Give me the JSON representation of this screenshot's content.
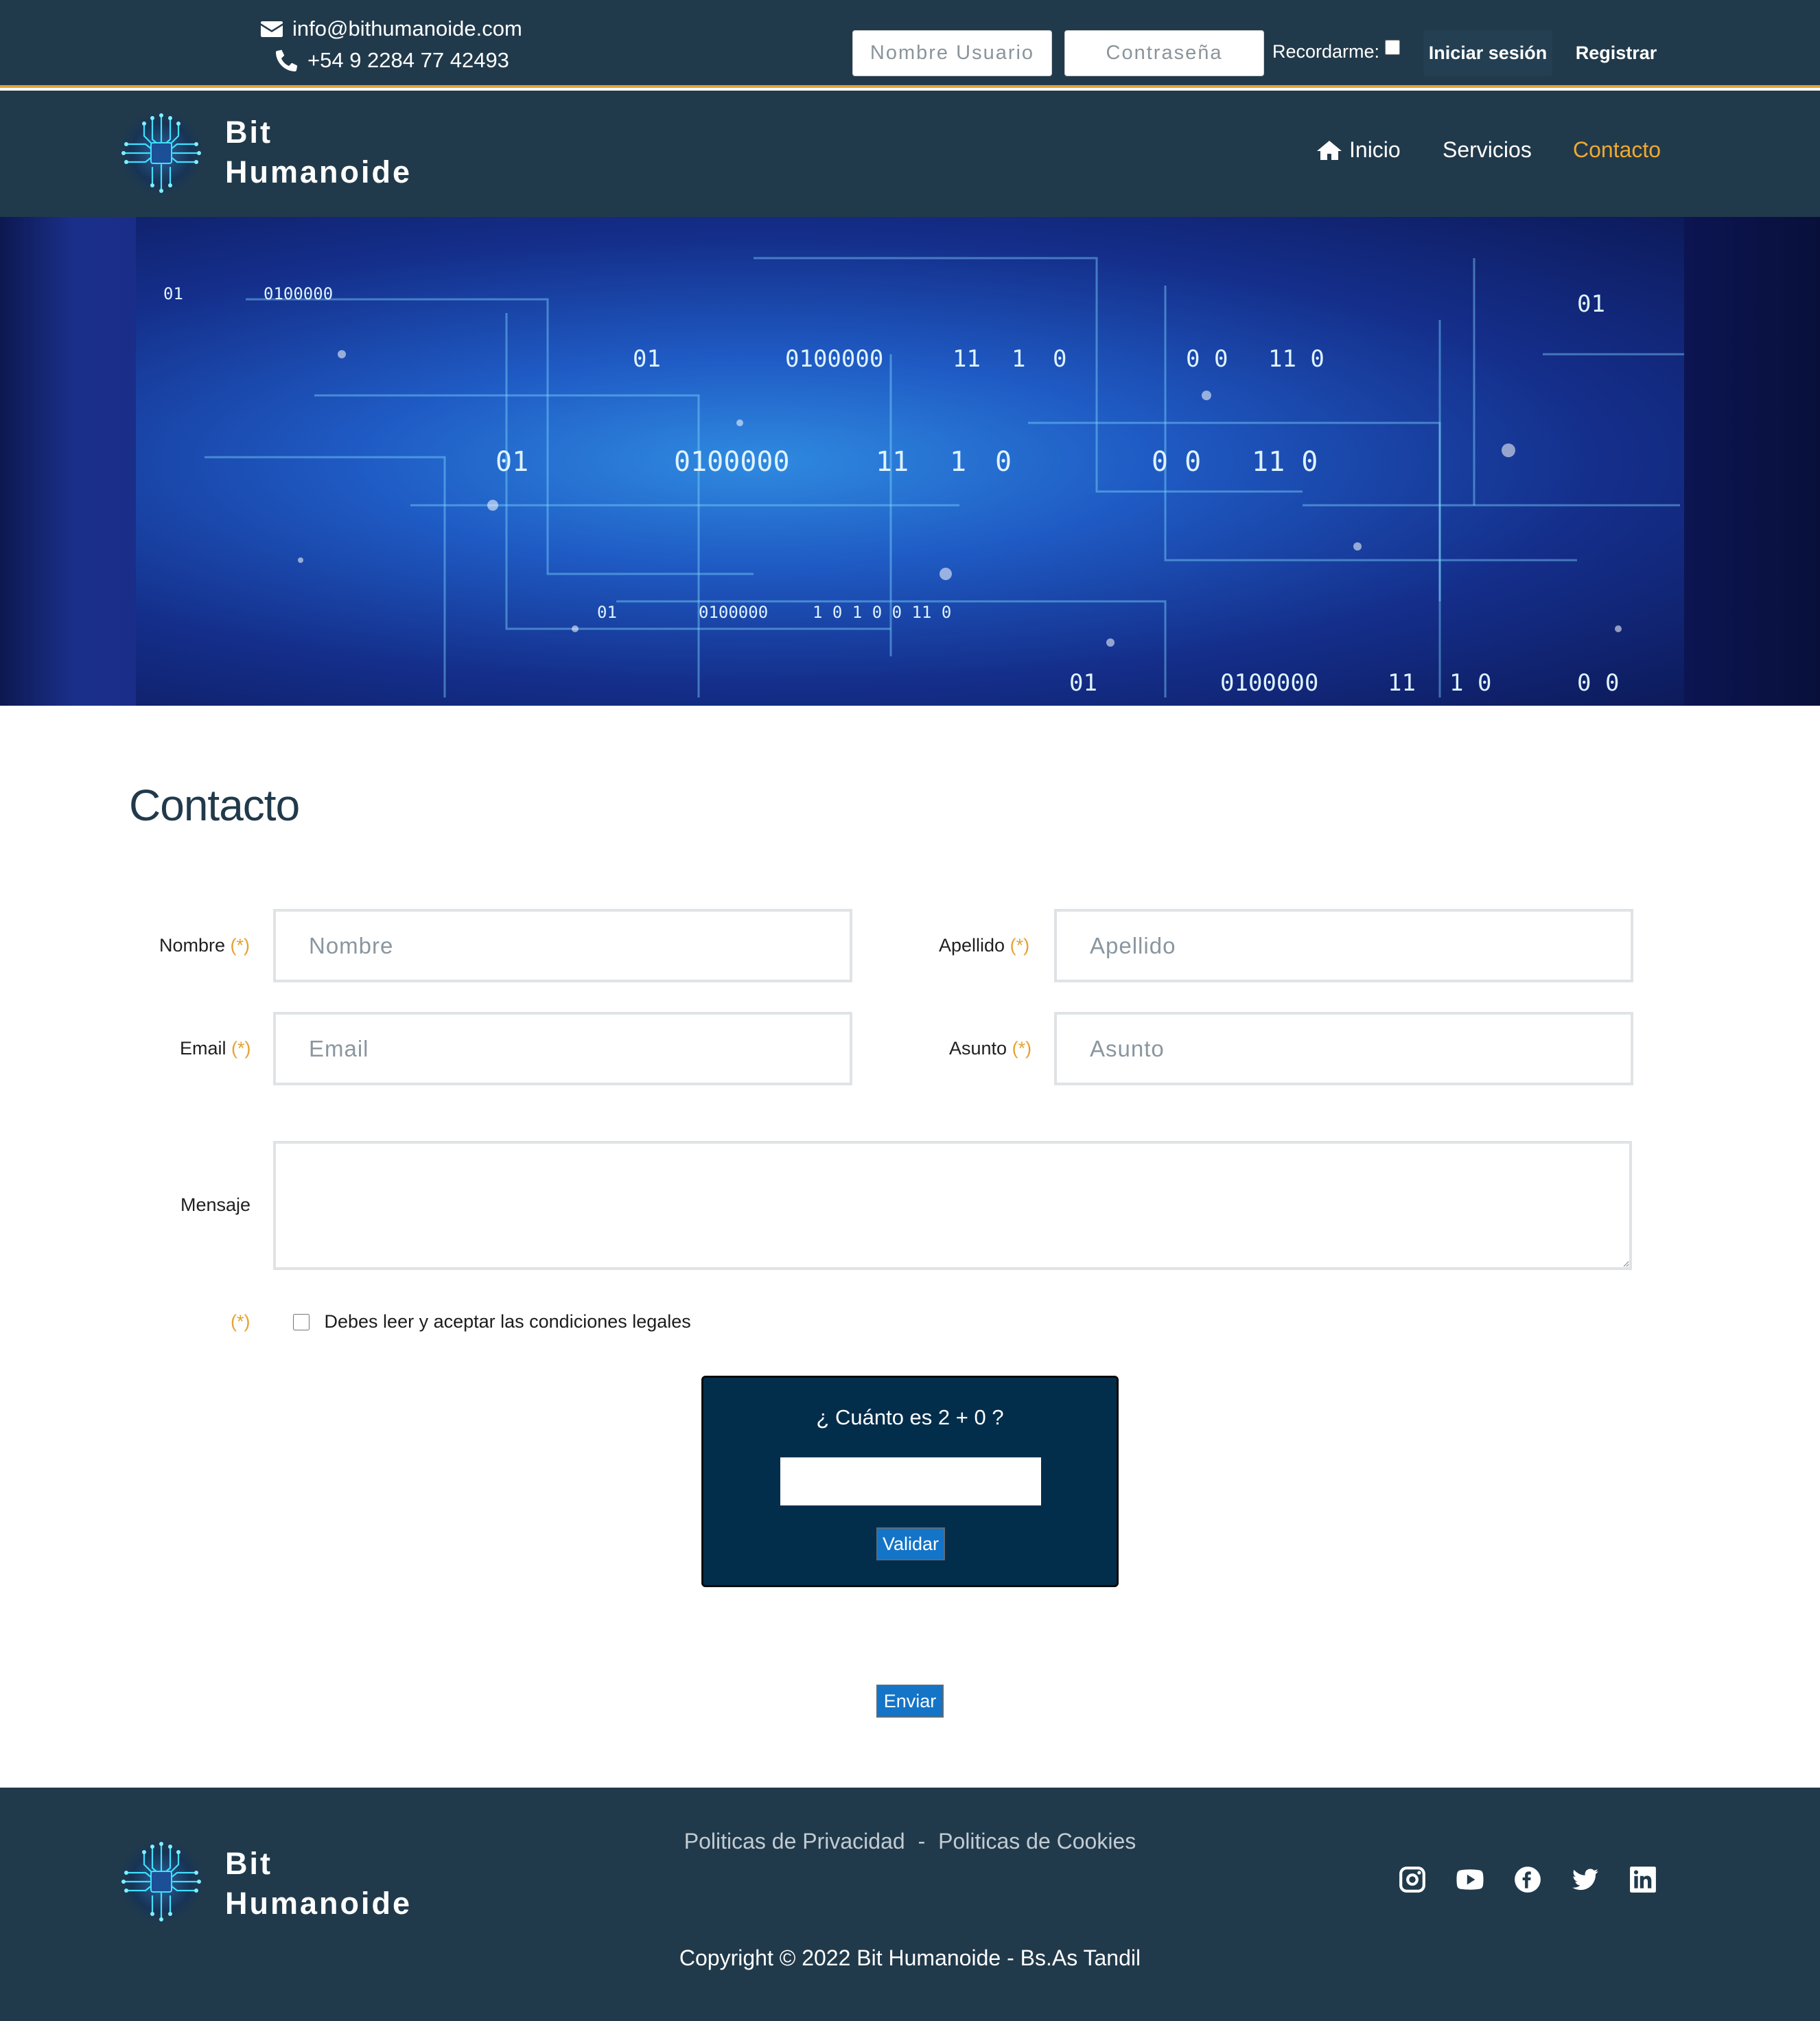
{
  "topbar": {
    "email": "info@bithumanoide.com",
    "phone": "+54 9 2284 77 42493",
    "username_placeholder": "Nombre Usuario",
    "password_placeholder": "Contraseña",
    "remember_label": "Recordarme:",
    "login_label": "Iniciar sesión",
    "register_label": "Registrar"
  },
  "brand": {
    "line1": "Bit",
    "line2": "Humanoide"
  },
  "nav": {
    "items": [
      {
        "label": "Inicio",
        "icon": "home-icon"
      },
      {
        "label": "Servicios"
      },
      {
        "label": "Contacto",
        "active": true
      }
    ]
  },
  "hero": {
    "binary_strings": [
      "01",
      "0100000",
      "11",
      "1",
      "0",
      "0 0",
      "11 0",
      "1 0",
      "1 0  1  0 0  11 0"
    ]
  },
  "content": {
    "title": "Contacto",
    "required_mark": "(*)",
    "fields": {
      "nombre_label": "Nombre",
      "nombre_placeholder": "Nombre",
      "apellido_label": "Apellido",
      "apellido_placeholder": "Apellido",
      "email_label": "Email",
      "email_placeholder": "Email",
      "asunto_label": "Asunto",
      "asunto_placeholder": "Asunto",
      "mensaje_label": "Mensaje"
    },
    "terms_label": "Debes leer y aceptar las condiciones legales",
    "captcha": {
      "question": "¿ Cuánto es 2 + 0 ?",
      "button": "Validar"
    },
    "submit": "Enviar"
  },
  "footer": {
    "privacy": "Politicas de Privacidad",
    "separator": "-",
    "cookies": "Politicas de Cookies",
    "copyright": "Copyright © 2022 Bit Humanoide - Bs.As Tandil",
    "social": [
      "instagram-icon",
      "youtube-icon",
      "facebook-icon",
      "twitter-icon",
      "linkedin-icon"
    ]
  },
  "colors": {
    "header_bg": "#213a4b",
    "accent": "#e5a233",
    "nav_active": "#f0a830",
    "captcha_bg": "#032e4b",
    "button_blue": "#1474c8"
  }
}
